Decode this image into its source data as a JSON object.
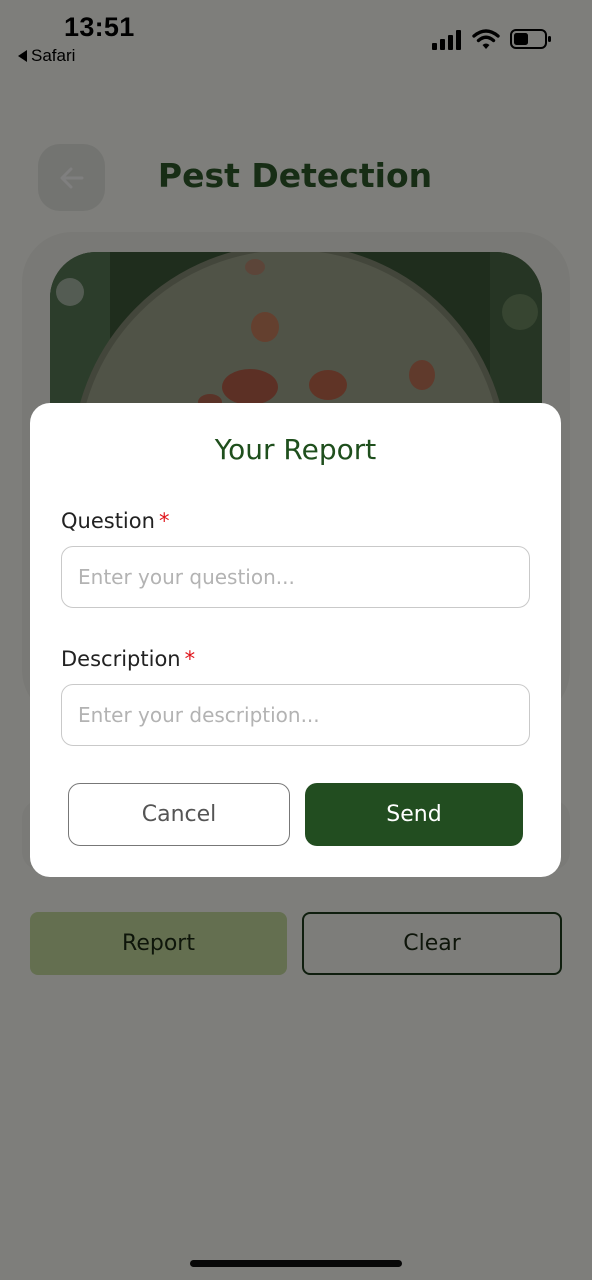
{
  "status_bar": {
    "time": "13:51",
    "back_app": "Safari",
    "icons": [
      "signal-icon",
      "wifi-icon",
      "battery-icon"
    ]
  },
  "header": {
    "title": "Pest Detection",
    "back_icon": "arrow-left-icon"
  },
  "actions": {
    "report_label": "Report",
    "clear_label": "Clear"
  },
  "modal": {
    "title": "Your Report",
    "question_label": "Question",
    "question_placeholder": "Enter your question...",
    "question_value": "",
    "description_label": "Description",
    "description_placeholder": "Enter your description...",
    "description_value": "",
    "required_marker": "*",
    "cancel_label": "Cancel",
    "send_label": "Send"
  },
  "colors": {
    "brand_green": "#224d20",
    "title_green": "#2e5a2a",
    "report_button": "#c9dea0",
    "required": "#e0141b",
    "overlay": "rgba(0,0,0,0.5)"
  }
}
